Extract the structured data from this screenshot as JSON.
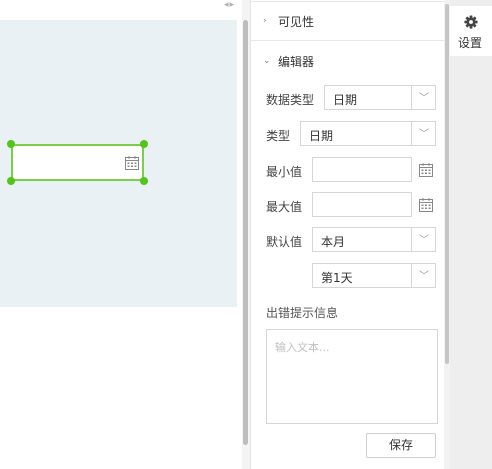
{
  "canvas": {
    "collapse_arrows": "◂▸"
  },
  "panel": {
    "sections": {
      "visibility": "可见性",
      "editor": "编辑器"
    },
    "fields": {
      "data_type": {
        "label": "数据类型",
        "value": "日期"
      },
      "type": {
        "label": "类型",
        "value": "日期"
      },
      "min_value": {
        "label": "最小值",
        "value": ""
      },
      "max_value": {
        "label": "最大值",
        "value": ""
      },
      "default_value": {
        "label": "默认值",
        "value": "本月",
        "secondary_value": "第1天"
      }
    },
    "error_message": {
      "label": "出错提示信息",
      "placeholder": "输入文本..."
    },
    "save_label": "保存"
  },
  "sidebar": {
    "settings_label": "设置",
    "settings_icon": "gear-icon"
  },
  "colors": {
    "canvas_bg": "#e9f1f4",
    "selection": "#52c41a"
  }
}
